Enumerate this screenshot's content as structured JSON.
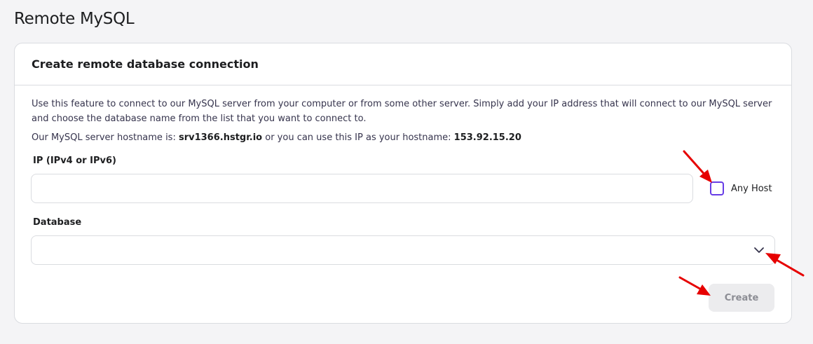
{
  "page": {
    "title": "Remote MySQL"
  },
  "card": {
    "title": "Create remote database connection",
    "description": "Use this feature to connect to our MySQL server from your computer or from some other server. Simply add your IP address that will connect to our MySQL server and choose the database name from the list that you want to connect to.",
    "host_prefix": "Our MySQL server hostname is: ",
    "hostname": "srv1366.hstgr.io",
    "host_middle": " or you can use this IP as your hostname: ",
    "host_ip": "153.92.15.20"
  },
  "ip_field": {
    "label": "IP (IPv4 or IPv6)",
    "value": "",
    "placeholder": ""
  },
  "any_host": {
    "label": "Any Host",
    "checked": false
  },
  "database_field": {
    "label": "Database",
    "selected": ""
  },
  "create_button": {
    "label": "Create",
    "disabled": true
  },
  "colors": {
    "accent": "#673de6",
    "annotation_arrow": "#e60000"
  },
  "icons": {
    "dropdown": "chevron-down-icon"
  }
}
